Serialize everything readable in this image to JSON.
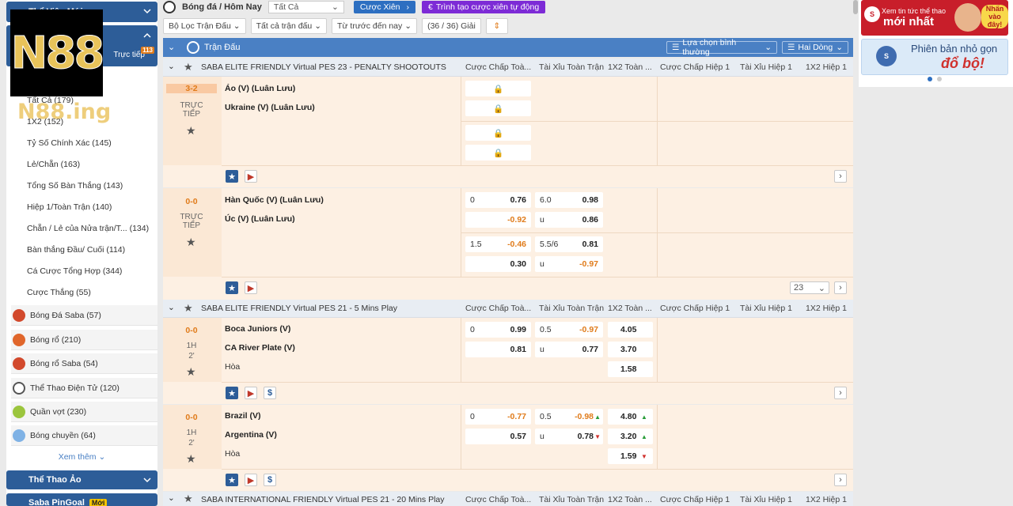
{
  "logo": {
    "text": "N88",
    "watermark": "N88.ing"
  },
  "sidebar": {
    "header1": "Thể Viện Mới",
    "live_label": "Trực tiếp",
    "live_count": "113",
    "items": [
      {
        "label": "Tất Cả (179)"
      },
      {
        "label": "1X2 (152)"
      },
      {
        "label": "Tỷ Số Chính Xác (145)"
      },
      {
        "label": "Lẻ/Chẵn (163)"
      },
      {
        "label": "Tổng Số Bàn Thắng (143)"
      },
      {
        "label": "Hiệp 1/Toàn Trận (140)"
      },
      {
        "label": "Chẵn / Lẻ của Nửa trận/T... (134)"
      },
      {
        "label": "Bàn thắng Đầu/ Cuối (114)"
      },
      {
        "label": "Cá Cược Tổng Hợp (344)"
      },
      {
        "label": "Cược Thắng (55)"
      }
    ],
    "sports": [
      {
        "label": "Bóng Đá Saba (57)",
        "color": "#d2492c"
      },
      {
        "label": "Bóng rổ (210)",
        "color": "#e0662b"
      },
      {
        "label": "Bóng rổ Saba (54)",
        "color": "#d2492c"
      },
      {
        "label": "Thể Thao Điện Tử (120)",
        "color": "#555555"
      },
      {
        "label": "Quần vợt (230)",
        "color": "#9bc53d"
      },
      {
        "label": "Bóng chuyền (64)",
        "color": "#7fb2e5"
      }
    ],
    "see_more": "Xem thêm",
    "section_virtual": "Thể Thao Ảo",
    "section_pingoal": "Saba PinGoal",
    "pingoal_badge": "Mới"
  },
  "topbar": {
    "breadcrumb": "Bóng đá / Hôm Nay",
    "filter_all": "Tất Cả",
    "parlay_button": "Cược Xiên",
    "builder_button": "Trình tạo cược xiên tự động"
  },
  "filters": {
    "match_filter": "Bộ Lọc Trận Đấu",
    "all_matches": "Tất cả trận đấu",
    "time_filter": "Từ trước đến nay",
    "count": "(36 / 36) Giải"
  },
  "mainhead": {
    "title": "Trận Đấu",
    "odds_select": "Lựa chọn bình thường",
    "lines_select": "Hai Dòng"
  },
  "columns": [
    "Cược Chấp Toà...",
    "Tài Xỉu Toàn Trận",
    "1X2 Toàn ...",
    "Cược Chấp Hiệp 1",
    "Tài Xỉu Hiệp 1",
    "1X2 Hiệp 1"
  ],
  "leagues": [
    {
      "name": "SABA ELITE FRIENDLY Virtual PES 23 - PENALTY SHOOTOUTS"
    },
    {
      "name": "SABA ELITE FRIENDLY Virtual PES 21 - 5 Mins Play"
    },
    {
      "name": "SABA INTERNATIONAL FRIENDLY Virtual PES 21 - 20 Mins Play"
    }
  ],
  "matches": [
    {
      "score": "3-2",
      "status": "TRỰC\nTIẾP",
      "home": "Áo (V) (Luân Lưu)",
      "away": "Ukraine (V) (Luân Lưu)"
    },
    {
      "score": "0-0",
      "status": "TRỰC\nTIẾP",
      "home": "Hàn Quốc (V) (Luân Lưu)",
      "away": "Úc (V) (Luân Lưu)",
      "r1": {
        "hcap": "0",
        "hodd": "0.76",
        "ou": "6.0",
        "ouodd": "0.98"
      },
      "r2": {
        "hodd": "-0.92",
        "ou": "u",
        "ouodd": "0.86"
      },
      "r3": {
        "hcap": "1.5",
        "hodd": "-0.46",
        "ou": "5.5/6",
        "ouodd": "0.81"
      },
      "r4": {
        "hodd": "0.30",
        "ou": "u",
        "ouodd": "-0.97"
      },
      "more": "23"
    },
    {
      "score": "0-0",
      "period": "1H",
      "minute": "2'",
      "home": "Boca Juniors (V)",
      "away": "CA River Plate (V)",
      "draw": "Hòa",
      "r1": {
        "hcap": "0",
        "hodd": "0.99",
        "ou": "0.5",
        "ouodd": "-0.97",
        "x12": "4.05"
      },
      "r2": {
        "hodd": "0.81",
        "ou": "u",
        "ouodd": "0.77",
        "x12": "3.70"
      },
      "r3": {
        "x12": "1.58"
      }
    },
    {
      "score": "0-0",
      "period": "1H",
      "minute": "2'",
      "home": "Brazil (V)",
      "away": "Argentina (V)",
      "draw": "Hòa",
      "r1": {
        "hcap": "0",
        "hodd": "-0.77",
        "ou": "0.5",
        "ouodd": "-0.98",
        "x12": "4.80"
      },
      "r2": {
        "hodd": "0.57",
        "ou": "u",
        "ouodd": "0.78",
        "x12": "3.20"
      },
      "r3": {
        "x12": "1.59"
      }
    }
  ],
  "ads": {
    "ad1_line1": "Xem tin tức thể thao",
    "ad1_line2": "mới nhất",
    "ad1_tag": "Nhấn vào đây!",
    "ad2_line1": "Phiên bản nhỏ gọn",
    "ad2_line2": "đổ bộ!"
  }
}
